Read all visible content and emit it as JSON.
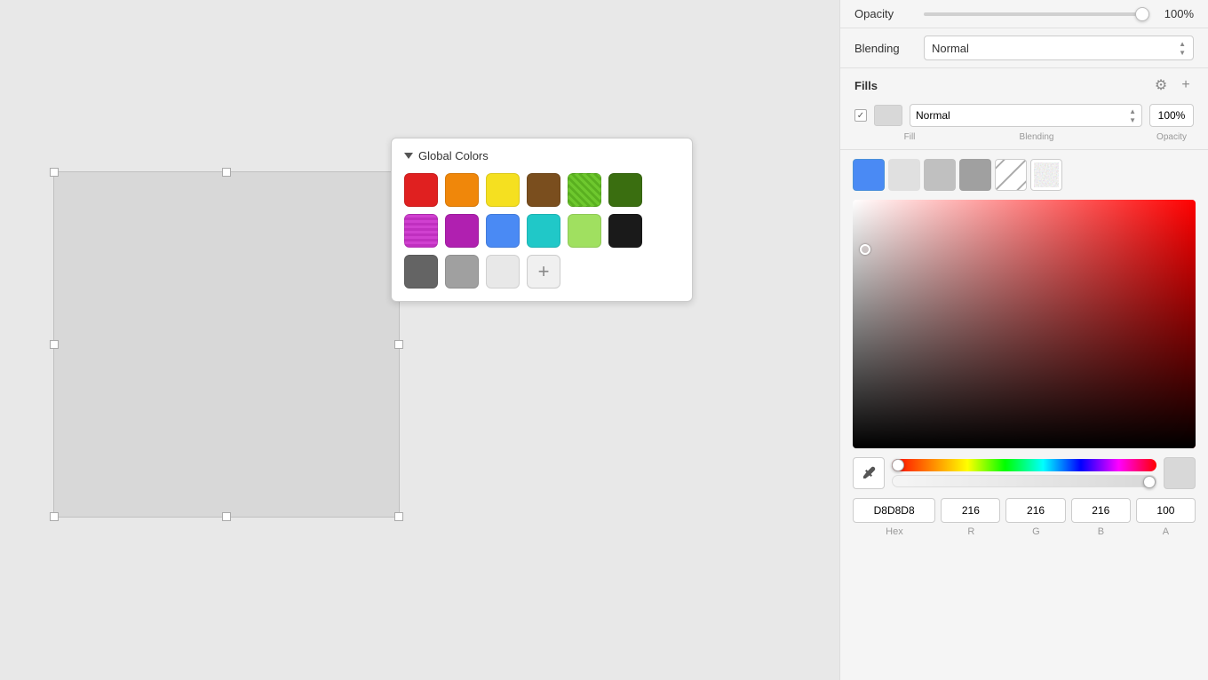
{
  "canvas": {
    "shape_background": "#d8d8d8",
    "canvas_background": "#e8e8e8"
  },
  "global_colors": {
    "title": "Global Colors",
    "swatches": [
      {
        "color": "#e02020",
        "label": "Red"
      },
      {
        "color": "#f0870a",
        "label": "Orange"
      },
      {
        "color": "#f5e020",
        "label": "Yellow"
      },
      {
        "color": "#7a4e1e",
        "label": "Brown"
      },
      {
        "color": "#6ec82e",
        "label": "Green Lime"
      },
      {
        "color": "#3a6e10",
        "label": "Dark Green"
      },
      {
        "color": "#c030c0",
        "label": "Purple Pattern"
      },
      {
        "color": "#b020b0",
        "label": "Purple"
      },
      {
        "color": "#4a8af4",
        "label": "Blue"
      },
      {
        "color": "#20c8c8",
        "label": "Cyan"
      },
      {
        "color": "#a0e060",
        "label": "Light Green"
      },
      {
        "color": "#1a1a1a",
        "label": "Black"
      },
      {
        "color": "#646464",
        "label": "Dark Gray"
      },
      {
        "color": "#a0a0a0",
        "label": "Gray"
      },
      {
        "color": "#e8e8e8",
        "label": "Light Gray"
      }
    ],
    "add_label": "+"
  },
  "panel": {
    "opacity_label": "Opacity",
    "opacity_value": "100%",
    "blending_label": "Blending",
    "blending_value": "Normal",
    "fills_title": "Fills",
    "fill_blending_value": "Normal",
    "fill_opacity_value": "100%",
    "fill_label_fill": "Fill",
    "fill_label_blending": "Blending",
    "fill_label_opacity": "Opacity",
    "hex_value": "D8D8D8",
    "r_value": "216",
    "g_value": "216",
    "b_value": "216",
    "a_value": "100",
    "hex_label": "Hex",
    "r_label": "R",
    "g_label": "G",
    "b_label": "B",
    "a_label": "A"
  }
}
